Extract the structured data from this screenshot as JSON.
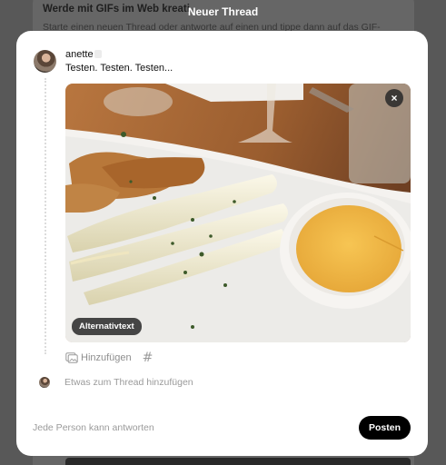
{
  "background": {
    "title": "Werde mit GIFs im Web kreati",
    "subtitle": "Starte einen neuen Thread oder antworte auf einen und tippe dann auf das GIF-"
  },
  "modal": {
    "title": "Neuer Thread",
    "username": "anette",
    "post_text": "Testen. Testen. Testen...",
    "image": {
      "close_label": "×",
      "alt_text_label": "Alternativtext"
    },
    "add_label": "Hinzufügen",
    "hashtag_label": "#",
    "thread_add_placeholder": "Etwas zum Thread hinzufügen",
    "reply_option": "Jede Person kann antworten",
    "post_button": "Posten"
  },
  "icons": {
    "avatar": "avatar",
    "image_add": "image-gallery-icon",
    "hashtag": "hashtag-icon",
    "close": "close-icon"
  }
}
